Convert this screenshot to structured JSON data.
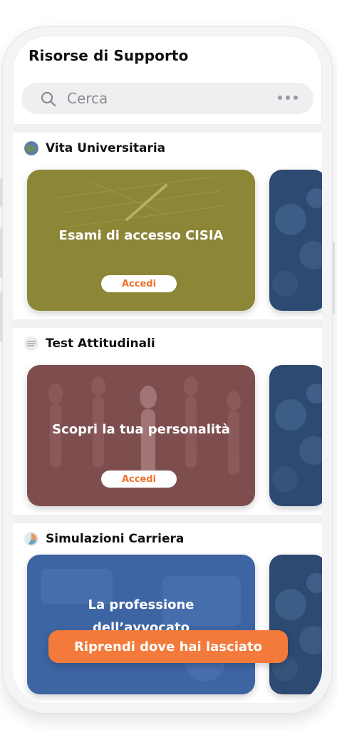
{
  "header": {
    "title": "Risorse di Supporto"
  },
  "search": {
    "placeholder": "Cerca"
  },
  "sections": [
    {
      "title": "Vita Universitaria",
      "icon": "globe-icon",
      "card": {
        "title_lines": [
          "Esami di accesso CISIA"
        ],
        "button": "Accedi",
        "color": "#8c8637"
      }
    },
    {
      "title": "Test Attitudinali",
      "icon": "document-icon",
      "card": {
        "title_lines": [
          "Scopri la tua personalità"
        ],
        "button": "Accedi",
        "color": "#7e4e4e"
      }
    },
    {
      "title": "Simulazioni Carriera",
      "icon": "chart-icon",
      "card": {
        "title_lines": [
          "La professione",
          "dell’avvocato"
        ],
        "color": "#3d64a3"
      }
    }
  ],
  "resume_button": "Riprendi dove hai lasciato",
  "colors": {
    "accent": "#f37a3a",
    "peek_card": "#2c4a72"
  }
}
